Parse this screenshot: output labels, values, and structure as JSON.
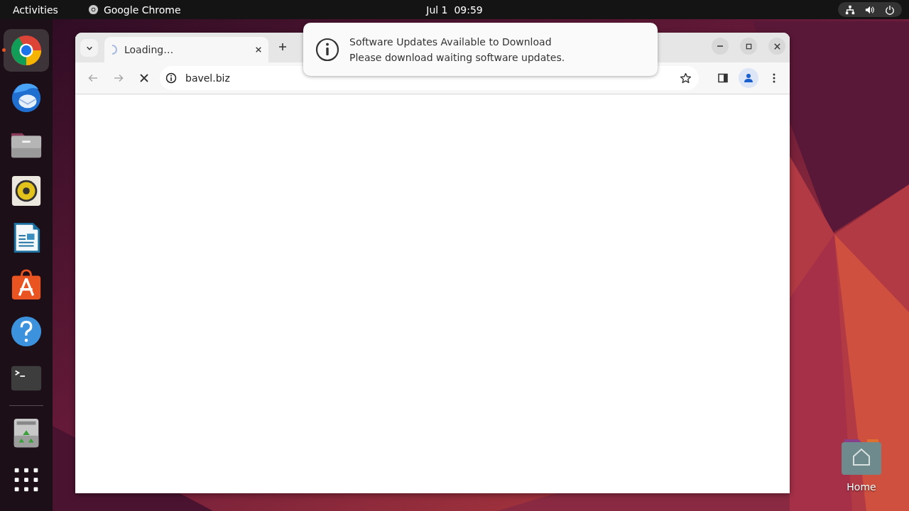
{
  "top_bar": {
    "activities": "Activities",
    "app_name": "Google Chrome",
    "clock": "Jul 1  09:59"
  },
  "dock": {
    "items": [
      {
        "kind": "chrome",
        "running": true,
        "selected": true
      },
      {
        "kind": "mail",
        "running": false,
        "selected": false
      },
      {
        "kind": "files",
        "running": false,
        "selected": false
      },
      {
        "kind": "speaker",
        "running": false,
        "selected": false
      },
      {
        "kind": "writer",
        "running": false,
        "selected": false
      },
      {
        "kind": "store",
        "running": false,
        "selected": false
      },
      {
        "kind": "help",
        "running": false,
        "selected": false
      },
      {
        "kind": "terminal",
        "running": false,
        "selected": false
      },
      {
        "kind": "separator"
      },
      {
        "kind": "trash",
        "running": false,
        "selected": false
      },
      {
        "kind": "apps",
        "running": false,
        "selected": false
      }
    ]
  },
  "browser": {
    "tabs": [
      {
        "title": "Loading…",
        "loading": true,
        "selected": true
      }
    ],
    "address": "bavel.biz",
    "loading": true
  },
  "notification": {
    "title": "Software Updates Available to Download",
    "body": "Please download waiting software updates."
  },
  "desktop_icons": [
    {
      "label": "Home"
    }
  ]
}
